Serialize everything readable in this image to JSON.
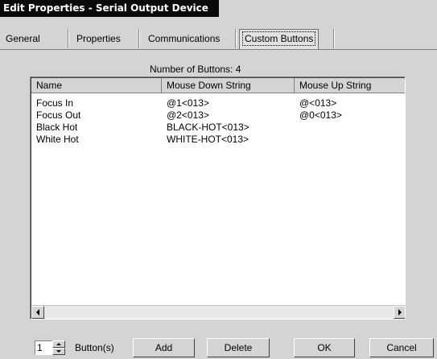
{
  "window": {
    "title": "Edit Properties - Serial Output Device"
  },
  "tabs": [
    {
      "label": "General"
    },
    {
      "label": "Properties"
    },
    {
      "label": "Communications"
    },
    {
      "label": "Custom Buttons",
      "active": true
    }
  ],
  "button_count_text": "Number of Buttons: 4",
  "table": {
    "columns": [
      "Name",
      "Mouse Down String",
      "Mouse Up String"
    ],
    "rows": [
      {
        "name": "Focus In",
        "down": "@1<013>",
        "up": "@<013>"
      },
      {
        "name": "Focus Out",
        "down": "@2<013>",
        "up": "@0<013>"
      },
      {
        "name": "Black Hot",
        "down": "BLACK-HOT<013>",
        "up": ""
      },
      {
        "name": "White Hot",
        "down": "WHITE-HOT<013>",
        "up": ""
      }
    ]
  },
  "footer": {
    "spinner_value": "1",
    "buttons_label": "Button(s)",
    "add_label": "Add",
    "delete_label": "Delete",
    "ok_label": "OK",
    "cancel_label": "Cancel"
  },
  "colors": {
    "titlebar_bg": "#0a0a0a",
    "dialog_bg": "#d4d4d4",
    "list_bg": "#ffffff"
  },
  "icons": [
    "scroll-left-arrow-icon",
    "scroll-right-arrow-icon",
    "spin-up-arrow-icon",
    "spin-down-arrow-icon"
  ]
}
